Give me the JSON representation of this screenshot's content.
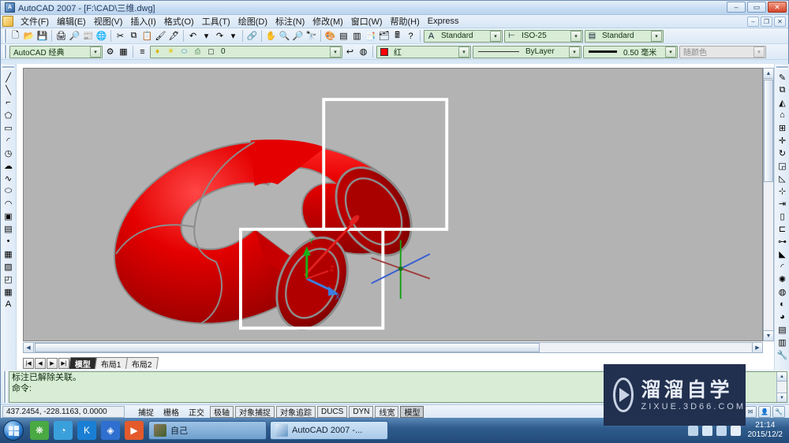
{
  "window": {
    "title": "AutoCAD 2007 - [F:\\CAD\\三维.dwg]",
    "app_icon": "autocad-icon",
    "minimize": "–",
    "maximize": "▭",
    "close": "✕",
    "mdi_minimize": "–",
    "mdi_restore": "❐",
    "mdi_close": "✕"
  },
  "menubar": {
    "items": [
      {
        "label": "文件(F)"
      },
      {
        "label": "编辑(E)"
      },
      {
        "label": "视图(V)"
      },
      {
        "label": "插入(I)"
      },
      {
        "label": "格式(O)"
      },
      {
        "label": "工具(T)"
      },
      {
        "label": "绘图(D)"
      },
      {
        "label": "标注(N)"
      },
      {
        "label": "修改(M)"
      },
      {
        "label": "窗口(W)"
      },
      {
        "label": "帮助(H)"
      },
      {
        "label": "Express"
      }
    ]
  },
  "standard_toolbar": {
    "buttons": [
      {
        "name": "new-icon",
        "glyph": "🗋"
      },
      {
        "name": "open-icon",
        "glyph": "📂"
      },
      {
        "name": "save-icon",
        "glyph": "💾"
      },
      {
        "name": "plot-icon",
        "glyph": "🖨"
      },
      {
        "name": "plot-preview-icon",
        "glyph": "🔎"
      },
      {
        "name": "publish-icon",
        "glyph": "📰"
      },
      {
        "name": "publish-web-icon",
        "glyph": "🌐"
      },
      {
        "name": "cut-icon",
        "glyph": "✂"
      },
      {
        "name": "copy-icon",
        "glyph": "⧉"
      },
      {
        "name": "paste-icon",
        "glyph": "📋"
      },
      {
        "name": "match-properties-icon",
        "glyph": "🖌"
      },
      {
        "name": "block-editor-icon",
        "glyph": "🖋"
      },
      {
        "name": "undo-icon",
        "glyph": "↶"
      },
      {
        "name": "undo-dropdown-icon",
        "glyph": "▾"
      },
      {
        "name": "redo-icon",
        "glyph": "↷"
      },
      {
        "name": "redo-dropdown-icon",
        "glyph": "▾"
      },
      {
        "name": "hyperlink-icon",
        "glyph": "🔗"
      },
      {
        "name": "pan-realtime-icon",
        "glyph": "✋"
      },
      {
        "name": "zoom-realtime-icon",
        "glyph": "🔍"
      },
      {
        "name": "zoom-window-icon",
        "glyph": "🔎"
      },
      {
        "name": "zoom-previous-icon",
        "glyph": "🔭"
      },
      {
        "name": "properties-icon",
        "glyph": "🎨"
      },
      {
        "name": "designcenter-icon",
        "glyph": "▤"
      },
      {
        "name": "tool-palettes-icon",
        "glyph": "▥"
      },
      {
        "name": "sheet-set-manager-icon",
        "glyph": "📑"
      },
      {
        "name": "markup-set-manager-icon",
        "glyph": "🗂"
      },
      {
        "name": "quickcalc-icon",
        "glyph": "🖩"
      },
      {
        "name": "help-icon",
        "glyph": "?"
      }
    ],
    "text_style": {
      "label": "Standard",
      "icon": "text-style-icon"
    },
    "dim_style": {
      "label": "ISO-25",
      "icon": "dim-style-icon"
    },
    "table_style": {
      "label": "Standard",
      "icon": "table-style-icon"
    }
  },
  "workspace_toolbar": {
    "workspace": {
      "label": "AutoCAD 经典"
    },
    "workspace_settings_icon": "workspace-settings-icon",
    "my_workspace_icon": "my-workspace-icon",
    "layer_properties_icon": "layer-properties-icon",
    "layer": {
      "value": "0",
      "state_icons": [
        "layer-on-icon",
        "layer-freeze-icon",
        "layer-lock-icon",
        "layer-plot-icon",
        "layer-color-icon"
      ]
    },
    "layer_previous_icon": "layer-previous-icon",
    "layer_states_icon": "layer-states-icon",
    "color": {
      "label": "红",
      "hex": "#ff0000"
    },
    "linetype": {
      "label": "ByLayer"
    },
    "lineweight": {
      "label": "0.50 毫米"
    },
    "plotstyle": {
      "label": "随颜色",
      "disabled": true
    }
  },
  "draw_toolbar": {
    "name": "draw-toolbar",
    "buttons": [
      {
        "name": "line-icon",
        "glyph": "╱"
      },
      {
        "name": "construction-line-icon",
        "glyph": "╲"
      },
      {
        "name": "polyline-icon",
        "glyph": "⌐"
      },
      {
        "name": "polygon-icon",
        "glyph": "⬠"
      },
      {
        "name": "rectangle-icon",
        "glyph": "▭"
      },
      {
        "name": "arc-icon",
        "glyph": "◜"
      },
      {
        "name": "circle-icon",
        "glyph": "◷"
      },
      {
        "name": "revision-cloud-icon",
        "glyph": "☁"
      },
      {
        "name": "spline-icon",
        "glyph": "∿"
      },
      {
        "name": "ellipse-icon",
        "glyph": "⬭"
      },
      {
        "name": "ellipse-arc-icon",
        "glyph": "◠"
      },
      {
        "name": "insert-block-icon",
        "glyph": "▣"
      },
      {
        "name": "make-block-icon",
        "glyph": "▤"
      },
      {
        "name": "point-icon",
        "glyph": "•"
      },
      {
        "name": "hatch-icon",
        "glyph": "▦"
      },
      {
        "name": "gradient-icon",
        "glyph": "▨"
      },
      {
        "name": "region-icon",
        "glyph": "◰"
      },
      {
        "name": "table-icon",
        "glyph": "▦"
      },
      {
        "name": "multiline-text-icon",
        "glyph": "A"
      }
    ]
  },
  "modify_toolbar": {
    "name": "modify-toolbar",
    "buttons": [
      {
        "name": "erase-icon",
        "glyph": "✎"
      },
      {
        "name": "copy-object-icon",
        "glyph": "⧉"
      },
      {
        "name": "mirror-icon",
        "glyph": "◭"
      },
      {
        "name": "offset-icon",
        "glyph": "⌂"
      },
      {
        "name": "array-icon",
        "glyph": "⊞"
      },
      {
        "name": "move-icon",
        "glyph": "✛"
      },
      {
        "name": "rotate-icon",
        "glyph": "↻"
      },
      {
        "name": "scale-icon",
        "glyph": "◲"
      },
      {
        "name": "stretch-icon",
        "glyph": "◺"
      },
      {
        "name": "trim-icon",
        "glyph": "⊹"
      },
      {
        "name": "extend-icon",
        "glyph": "⇥"
      },
      {
        "name": "break-at-point-icon",
        "glyph": "▯"
      },
      {
        "name": "break-icon",
        "glyph": "⊏"
      },
      {
        "name": "join-icon",
        "glyph": "⊶"
      },
      {
        "name": "chamfer-icon",
        "glyph": "◣"
      },
      {
        "name": "fillet-icon",
        "glyph": "◜"
      },
      {
        "name": "explode-icon",
        "glyph": "✺"
      },
      {
        "name": "3d-orbit-icon",
        "glyph": "◍"
      },
      {
        "name": "visual-styles-icon",
        "glyph": "◐"
      },
      {
        "name": "render-icon",
        "glyph": "◕"
      },
      {
        "name": "properties-panel-icon",
        "glyph": "▤"
      },
      {
        "name": "layer-tools-icon",
        "glyph": "▥"
      },
      {
        "name": "utility-icon",
        "glyph": "🔧"
      }
    ]
  },
  "drawing": {
    "background_hex": "#b3b3b3",
    "model_name": "red-pipe-bend-3d-solid",
    "model_color_hex": "#e00000",
    "edge_color_hex": "#8c8c8c",
    "selection_boxes": 2,
    "ucs_icon": {
      "name": "ucs-icon",
      "x_label": "X",
      "y_label": "Y",
      "z_label": "Z",
      "x_color": "#3a7de0",
      "y_color": "#18b218",
      "z_color": "#e02020"
    },
    "axis_tripod": {
      "name": "axis-tripod-icon"
    },
    "vscroll": {
      "up": "▲",
      "down": "▼"
    },
    "hscroll": {
      "left": "◀",
      "right": "▶"
    }
  },
  "layout_tabs": {
    "nav": {
      "first": "|◀",
      "prev": "◀",
      "next": "▶",
      "last": "▶|"
    },
    "tabs": [
      {
        "label": "模型",
        "active": true
      },
      {
        "label": "布局1",
        "active": false
      },
      {
        "label": "布局2",
        "active": false
      }
    ]
  },
  "command_window": {
    "history": "标注已解除关联。",
    "prompt": "命令:",
    "scroll_up": "▲",
    "scroll_down": "▼"
  },
  "statusbar": {
    "coordinates": "437.2454, -228.1163, 0.0000",
    "toggles": [
      {
        "label": "捕捉",
        "style": "plain"
      },
      {
        "label": "栅格",
        "style": "plain"
      },
      {
        "label": "正交",
        "style": "plain"
      },
      {
        "label": "极轴",
        "style": "framed"
      },
      {
        "label": "对象捕捉",
        "style": "framed"
      },
      {
        "label": "对象追踪",
        "style": "framed"
      },
      {
        "label": "DUCS",
        "style": "framed"
      },
      {
        "label": "DYN",
        "style": "framed"
      },
      {
        "label": "线宽",
        "style": "framed"
      },
      {
        "label": "模型",
        "style": "pressed"
      }
    ],
    "tray_buttons": [
      {
        "name": "communication-center-icon",
        "glyph": "✉"
      },
      {
        "name": "manage-xrefs-icon",
        "glyph": "👤"
      },
      {
        "name": "toolbar-lock-icon",
        "glyph": "🔧"
      }
    ]
  },
  "taskbar": {
    "start_label": "start-orb",
    "quick_launch": [
      {
        "name": "photos-icon",
        "glyph": "❋",
        "hex": "#49a942"
      },
      {
        "name": "browser-icon",
        "glyph": "◔",
        "hex": "#3aa0dc"
      },
      {
        "name": "kingsoft-icon",
        "glyph": "K",
        "hex": "#1a7fd4"
      },
      {
        "name": "security-shield-icon",
        "glyph": "◈",
        "hex": "#2f6fd0"
      },
      {
        "name": "media-player-icon",
        "glyph": "▶",
        "hex": "#e45a2b"
      }
    ],
    "tasks": [
      {
        "label": "自己",
        "icon": "folder-thumbnail-icon",
        "active": false
      },
      {
        "label": "AutoCAD 2007 -...",
        "icon": "autocad-icon",
        "active": true
      }
    ],
    "tray": [
      {
        "name": "network-icon",
        "glyph": "▰"
      },
      {
        "name": "volume-icon",
        "glyph": "🔊"
      },
      {
        "name": "ime-icon",
        "glyph": "中"
      },
      {
        "name": "action-center-icon",
        "glyph": "⚑"
      }
    ],
    "clock": {
      "time": "21:14",
      "date": "2015/12/2"
    }
  },
  "watermark": {
    "logo_name": "play-button-logo",
    "title": "溜溜自学",
    "url": "ZIXUE.3D66.COM"
  }
}
